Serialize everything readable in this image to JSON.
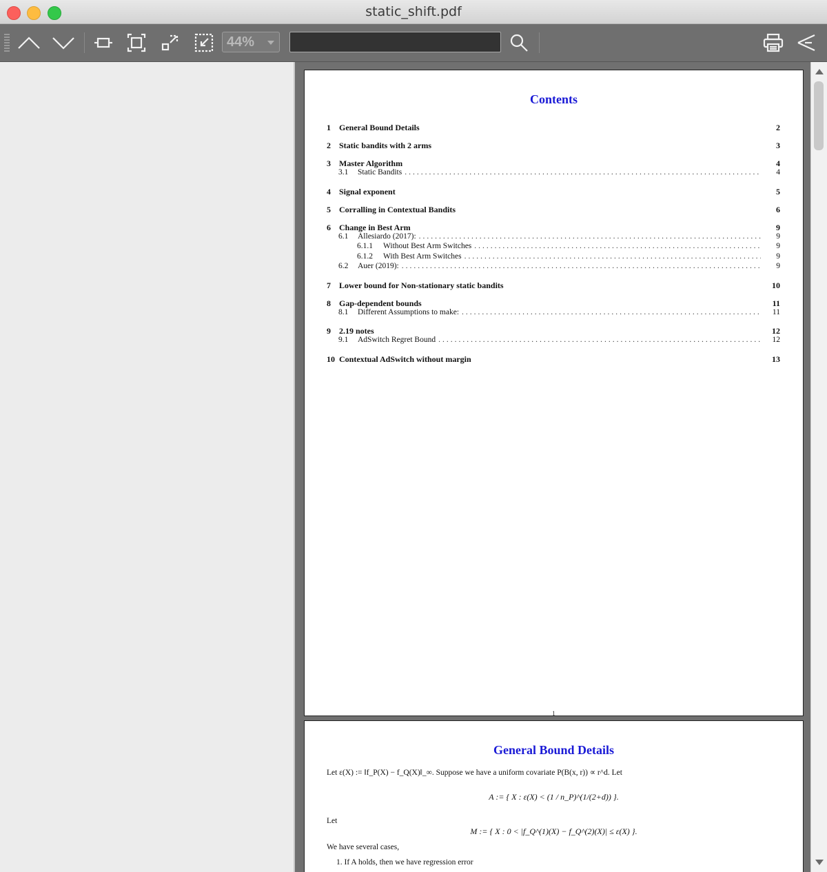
{
  "window": {
    "title": "static_shift.pdf"
  },
  "toolbar": {
    "zoom": "44%",
    "search_value": ""
  },
  "toc": {
    "title": "Contents",
    "entries": [
      {
        "num": "1",
        "title": "General Bound Details",
        "page": "2"
      },
      {
        "num": "2",
        "title": "Static bandits with 2 arms",
        "page": "3"
      },
      {
        "num": "3",
        "title": "Master Algorithm",
        "page": "4"
      },
      {
        "num": "3.1",
        "title": "Static Bandits",
        "page": "4"
      },
      {
        "num": "4",
        "title": "Signal exponent",
        "page": "5"
      },
      {
        "num": "5",
        "title": "Corralling in Contextual Bandits",
        "page": "6"
      },
      {
        "num": "6",
        "title": "Change in Best Arm",
        "page": "9"
      },
      {
        "num": "6.1",
        "title": "Allesiardo (2017):",
        "page": "9"
      },
      {
        "num": "6.1.1",
        "title": "Without Best Arm Switches",
        "page": "9"
      },
      {
        "num": "6.1.2",
        "title": "With Best Arm Switches",
        "page": "9"
      },
      {
        "num": "6.2",
        "title": "Auer (2019):",
        "page": "9"
      },
      {
        "num": "7",
        "title": "Lower bound for Non-stationary static bandits",
        "page": "10"
      },
      {
        "num": "8",
        "title": "Gap-dependent bounds",
        "page": "11"
      },
      {
        "num": "8.1",
        "title": "Different Assumptions to make:",
        "page": "11"
      },
      {
        "num": "9",
        "title": "2.19 notes",
        "page": "12"
      },
      {
        "num": "9.1",
        "title": "AdSwitch Regret Bound",
        "page": "12"
      },
      {
        "num": "10",
        "title": "Contextual AdSwitch without margin",
        "page": "13"
      }
    ],
    "page_number": "1"
  },
  "page2": {
    "heading": "General Bound Details",
    "para1": "Let ε(X) := ‖f_P(X) − f_Q(X)‖_∞. Suppose we have a uniform covariate P(B(x, r)) ∝ r^d. Let",
    "eq1": "A := { X : ε(X) < (1 / n_P)^(1/(2+d)) }.",
    "let": "Let",
    "eq2": "M := { X : 0 < |f_Q^(1)(X) − f_Q^(2)(X)| ≤ ε(X) }.",
    "para2": "We have several cases,",
    "item1": "1. If A holds, then we have regression error"
  },
  "colors": {
    "heading_blue": "#1a1ad6",
    "toolbar_gray": "#6f6f6f"
  }
}
